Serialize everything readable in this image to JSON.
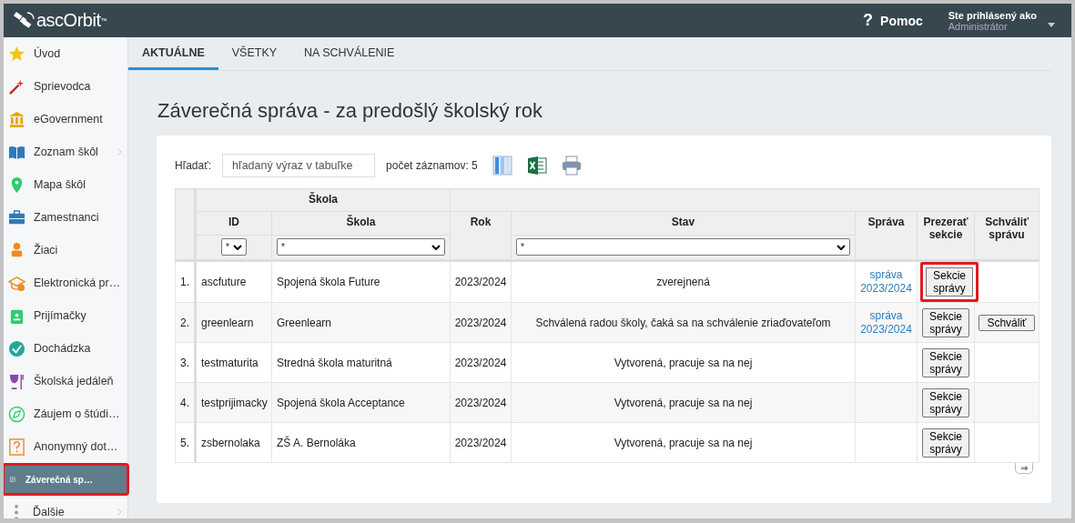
{
  "header": {
    "logo": "ascOrbit",
    "logo_mark": "™",
    "help": "Pomoc",
    "help_icon": "?",
    "user_label": "Ste prihlásený ako",
    "user_name": "Administrátor"
  },
  "sidebar": {
    "items": [
      {
        "label": "Úvod",
        "selected": false,
        "highlighted": false,
        "has_submenu": false
      },
      {
        "label": "Sprievodca",
        "selected": false,
        "highlighted": false,
        "has_submenu": false
      },
      {
        "label": "eGovernment",
        "selected": false,
        "highlighted": false,
        "has_submenu": false
      },
      {
        "label": "Zoznam škôl",
        "selected": false,
        "highlighted": false,
        "has_submenu": true
      },
      {
        "label": "Mapa škôl",
        "selected": false,
        "highlighted": false,
        "has_submenu": false
      },
      {
        "label": "Zamestnanci",
        "selected": false,
        "highlighted": false,
        "has_submenu": false
      },
      {
        "label": "Žiaci",
        "selected": false,
        "highlighted": false,
        "has_submenu": false
      },
      {
        "label": "Elektronická pr…",
        "selected": false,
        "highlighted": false,
        "has_submenu": false
      },
      {
        "label": "Prijímačky",
        "selected": false,
        "highlighted": false,
        "has_submenu": false
      },
      {
        "label": "Dochádzka",
        "selected": false,
        "highlighted": false,
        "has_submenu": false
      },
      {
        "label": "Školská jedáleň",
        "selected": false,
        "highlighted": false,
        "has_submenu": false
      },
      {
        "label": "Záujem o štúdi…",
        "selected": false,
        "highlighted": false,
        "has_submenu": false
      },
      {
        "label": "Anonymný dot…",
        "selected": false,
        "highlighted": false,
        "has_submenu": false
      },
      {
        "label": "Záverečná sp…",
        "selected": true,
        "highlighted": true,
        "has_submenu": false
      },
      {
        "label": "Ďalšie",
        "selected": false,
        "highlighted": false,
        "has_submenu": true
      }
    ]
  },
  "tabs": [
    {
      "label": "AKTUÁLNE",
      "selected": true
    },
    {
      "label": "VŠETKY",
      "selected": false
    },
    {
      "label": "NA SCHVÁLENIE",
      "selected": false
    }
  ],
  "page_title": "Záverečná správa - za predošlý školský rok",
  "search": {
    "label": "Hľadať:",
    "placeholder": "hľadaný výraz v tabuľke"
  },
  "record_count": "počet záznamov: 5",
  "table": {
    "group_header": "Škola",
    "columns": [
      "ID",
      "Škola",
      "Rok",
      "Stav",
      "Správa",
      "Prezerať sekcie",
      "Schváliť správu"
    ],
    "filters": {
      "id": "*",
      "school": "*",
      "status": "*"
    },
    "rows": [
      {
        "number": "1.",
        "id": "ascfuture",
        "school": "Spojená škola Future",
        "year": "2023/2024",
        "status": "zverejnená",
        "report_link": "správa 2023/2024",
        "sections_button": "Sekcie správy",
        "sections_highlighted": true,
        "approve_button": null
      },
      {
        "number": "2.",
        "id": "greenlearn",
        "school": "Greenlearn",
        "year": "2023/2024",
        "status": "Schválená radou školy, čaká sa na schválenie zriaďovateľom",
        "report_link": "správa 2023/2024",
        "sections_button": "Sekcie správy",
        "sections_highlighted": false,
        "approve_button": "Schváliť"
      },
      {
        "number": "3.",
        "id": "testmaturita",
        "school": "Stredná škola maturitná",
        "year": "2023/2024",
        "status": "Vytvorená, pracuje sa na nej",
        "report_link": null,
        "sections_button": "Sekcie správy",
        "sections_highlighted": false,
        "approve_button": null
      },
      {
        "number": "4.",
        "id": "testprijimacky",
        "school": "Spojená škola Acceptance",
        "year": "2023/2024",
        "status": "Vytvorená, pracuje sa na nej",
        "report_link": null,
        "sections_button": "Sekcie správy",
        "sections_highlighted": false,
        "approve_button": null
      },
      {
        "number": "5.",
        "id": "zsbernolaka",
        "school": "ZŠ A. Bernoláka",
        "year": "2023/2024",
        "status": "Vytvorená, pracuje sa na nej",
        "report_link": null,
        "sections_button": "Sekcie správy",
        "sections_highlighted": false,
        "approve_button": null
      }
    ],
    "scroll_button": "⇒"
  }
}
